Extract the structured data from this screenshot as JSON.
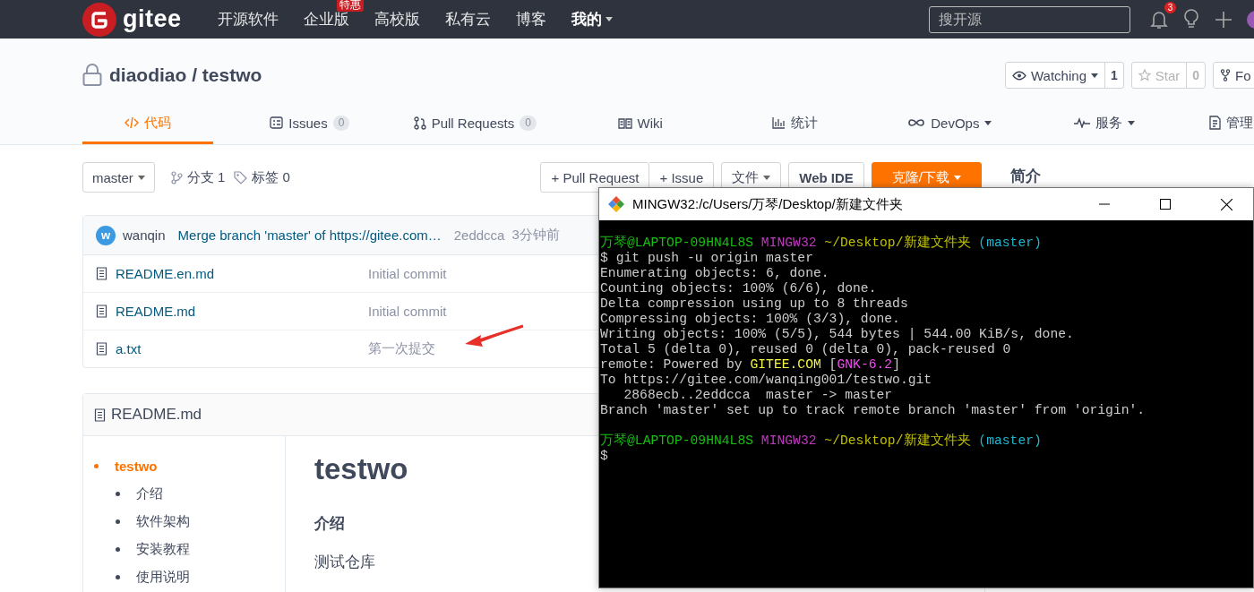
{
  "topnav": {
    "brand": "gitee",
    "links": [
      {
        "label": "开源软件",
        "kind": "link"
      },
      {
        "label": "企业版",
        "kind": "link",
        "badge": "特惠"
      },
      {
        "label": "高校版",
        "kind": "link"
      },
      {
        "label": "私有云",
        "kind": "link"
      },
      {
        "label": "博客",
        "kind": "link"
      },
      {
        "label": "我的",
        "kind": "menu"
      }
    ],
    "search": {
      "placeholder": "搜开源"
    },
    "notification_count": "3"
  },
  "repo": {
    "title": "diaodiao / testwo",
    "actions": [
      {
        "label": "Watching",
        "count": "1",
        "kind": "watch"
      },
      {
        "label": "Star",
        "count": "0",
        "kind": "star"
      },
      {
        "label": "Fo",
        "kind": "fork"
      }
    ]
  },
  "tabs": [
    {
      "label": "代码",
      "kind": "code",
      "dropdown": false,
      "selected": true
    },
    {
      "label": "Issues",
      "count": "0",
      "kind": "issues",
      "dropdown": false,
      "selected": false
    },
    {
      "label": "Pull Requests",
      "count": "0",
      "kind": "pulls",
      "dropdown": false,
      "selected": false
    },
    {
      "label": "Wiki",
      "kind": "wiki",
      "dropdown": false,
      "selected": false
    },
    {
      "label": "统计",
      "kind": "stats",
      "dropdown": false,
      "selected": false
    },
    {
      "label": "DevOps",
      "kind": "devops",
      "dropdown": true,
      "selected": false
    },
    {
      "label": "服务",
      "kind": "service",
      "dropdown": true,
      "selected": false
    },
    {
      "label": "管理",
      "kind": "admin",
      "dropdown": false,
      "selected": false
    }
  ],
  "branch_bar": {
    "branch": "master",
    "branches": "分支 1",
    "tags": "标签 0",
    "actions": [
      {
        "label": "+ Pull Request",
        "kind": "joined"
      },
      {
        "label": "+ Issue",
        "kind": "joined"
      },
      {
        "label": "文件",
        "kind": "dropdown"
      },
      {
        "label": "Web IDE",
        "kind": "strong"
      },
      {
        "label": "克隆/下载",
        "kind": "primary"
      }
    ]
  },
  "sidebar": {
    "title": "简介"
  },
  "last_commit": {
    "avatar": "w",
    "author": "wanqin",
    "message": "Merge branch 'master' of https://gitee.com…",
    "sha": "2eddcca",
    "time": "3分钟前"
  },
  "files": [
    {
      "name": "README.en.md",
      "commit": "Initial commit"
    },
    {
      "name": "README.md",
      "commit": "Initial commit"
    },
    {
      "name": "a.txt",
      "commit": "第一次提交"
    }
  ],
  "readme": {
    "filename": "README.md",
    "toc": [
      {
        "label": "testwo",
        "selected": true,
        "children": [
          {
            "label": "介绍",
            "selected": false
          },
          {
            "label": "软件架构",
            "selected": false
          },
          {
            "label": "安装教程",
            "selected": false
          },
          {
            "label": "使用说明",
            "selected": false
          }
        ]
      }
    ],
    "title": "testwo",
    "heading": "介绍",
    "text": "测试仓库"
  },
  "terminal": {
    "title": "MINGW32:/c/Users/万琴/Desktop/新建文件夹",
    "lines": [
      {
        "kind": "text",
        "segments": [
          {
            "text": "万琴@LAPTOP-09HN4L8S",
            "color": "#13c10e"
          },
          {
            "text": " MINGW32",
            "color": "#c037c0"
          },
          {
            "text": " ~/Desktop/新建文件夹",
            "color": "#c1c100"
          },
          {
            "text": " (master)",
            "color": "#1fb5d0"
          }
        ]
      },
      {
        "kind": "text",
        "segments": [
          {
            "text": "$ git push -u origin master",
            "color": "#cccccc"
          }
        ]
      },
      {
        "kind": "text",
        "segments": [
          {
            "text": "Enumerating objects: 6, done.",
            "color": "#cccccc"
          }
        ]
      },
      {
        "kind": "text",
        "segments": [
          {
            "text": "Counting objects: 100% (6/6), done.",
            "color": "#cccccc"
          }
        ]
      },
      {
        "kind": "text",
        "segments": [
          {
            "text": "Delta compression using up to 8 threads",
            "color": "#cccccc"
          }
        ]
      },
      {
        "kind": "text",
        "segments": [
          {
            "text": "Compressing objects: 100% (3/3), done.",
            "color": "#cccccc"
          }
        ]
      },
      {
        "kind": "text",
        "segments": [
          {
            "text": "Writing objects: 100% (5/5), 544 bytes | 544.00 KiB/s, done.",
            "color": "#cccccc"
          }
        ]
      },
      {
        "kind": "text",
        "segments": [
          {
            "text": "Total 5 (delta 0), reused 0 (delta 0), pack-reused 0",
            "color": "#cccccc"
          }
        ]
      },
      {
        "kind": "text",
        "segments": [
          {
            "text": "remote: Powered by ",
            "color": "#cccccc"
          },
          {
            "text": "GITEE.COM",
            "color": "#f5f543"
          },
          {
            "text": " [",
            "color": "#cccccc"
          },
          {
            "text": "GNK-6.2",
            "color": "#f04cf0"
          },
          {
            "text": "]",
            "color": "#cccccc"
          }
        ]
      },
      {
        "kind": "text",
        "segments": [
          {
            "text": "To https://gitee.com/wanqing001/testwo.git",
            "color": "#cccccc"
          }
        ]
      },
      {
        "kind": "text",
        "segments": [
          {
            "text": "   2868ecb..2eddcca  master -> master",
            "color": "#cccccc"
          }
        ]
      },
      {
        "kind": "text",
        "segments": [
          {
            "text": "Branch 'master' set up to track remote branch 'master' from 'origin'.",
            "color": "#cccccc"
          }
        ]
      },
      {
        "kind": "blank"
      },
      {
        "kind": "text",
        "segments": [
          {
            "text": "万琴@LAPTOP-09HN4L8S",
            "color": "#13c10e"
          },
          {
            "text": " MINGW32",
            "color": "#c037c0"
          },
          {
            "text": " ~/Desktop/新建文件夹",
            "color": "#c1c100"
          },
          {
            "text": " (master)",
            "color": "#1fb5d0"
          }
        ]
      },
      {
        "kind": "text",
        "segments": [
          {
            "text": "$",
            "color": "#cccccc"
          }
        ]
      }
    ]
  }
}
